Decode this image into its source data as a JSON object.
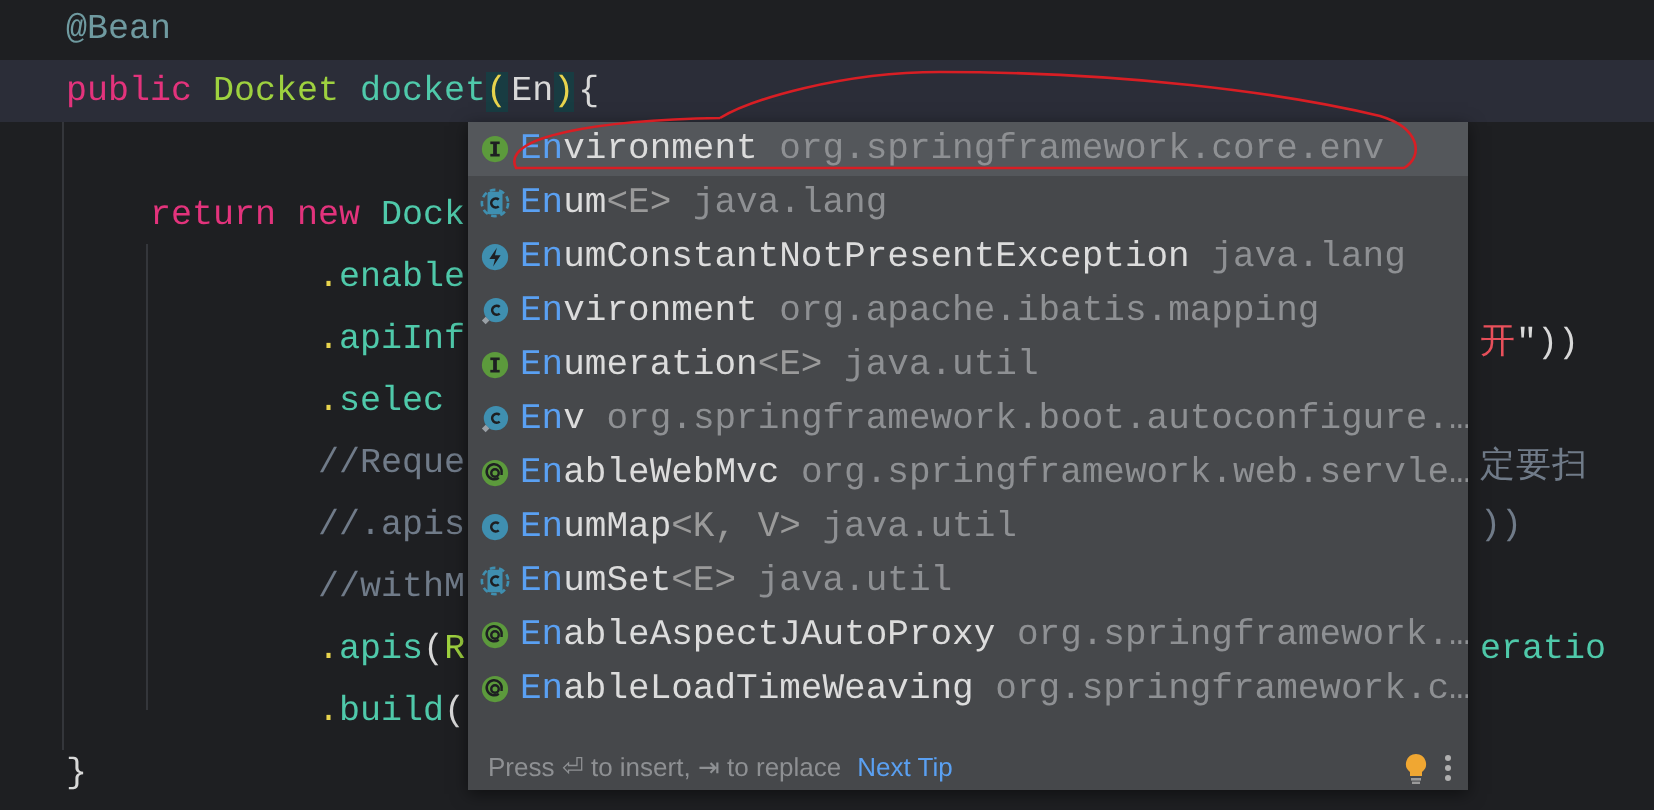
{
  "editor": {
    "lines": [
      {
        "current": false,
        "tokens": [
          {
            "kind": "annotation",
            "text": "@Bean"
          }
        ]
      },
      {
        "current": true,
        "tokens": [
          {
            "kind": "keyword",
            "text": "public "
          },
          {
            "kind": "type",
            "text": "Docket "
          },
          {
            "kind": "method",
            "text": "docket"
          },
          {
            "kind": "bracket-match",
            "text": "("
          },
          {
            "kind": "plain",
            "text": "En"
          },
          {
            "kind": "bracket-match",
            "text": ")"
          },
          {
            "kind": "plain",
            "text": "{"
          }
        ]
      },
      {
        "current": false
      },
      {
        "current": false,
        "tokens": [
          {
            "kind": "keyword",
            "text": "    return new "
          },
          {
            "kind": "method",
            "text": "Dock"
          }
        ]
      },
      {
        "current": false,
        "tokens": [
          {
            "kind": "punct",
            "text": "            ."
          },
          {
            "kind": "method",
            "text": "enable"
          }
        ]
      },
      {
        "current": false,
        "tokens": [
          {
            "kind": "punct",
            "text": "            ."
          },
          {
            "kind": "method",
            "text": "apiInf"
          }
        ],
        "right": [
          {
            "kind": "string",
            "text": "开"
          },
          {
            "kind": "plain",
            "text": "\"))"
          }
        ]
      },
      {
        "current": false,
        "tokens": [
          {
            "kind": "punct",
            "text": "            ."
          },
          {
            "kind": "method",
            "text": "selec"
          }
        ]
      },
      {
        "current": false,
        "tokens": [
          {
            "kind": "comment",
            "text": "            //Reque"
          }
        ],
        "right": [
          {
            "kind": "comment",
            "text": "定要扫"
          }
        ]
      },
      {
        "current": false,
        "tokens": [
          {
            "kind": "comment",
            "text": "            //.apis"
          }
        ],
        "right": [
          {
            "kind": "comment",
            "text": "))"
          }
        ]
      },
      {
        "current": false,
        "tokens": [
          {
            "kind": "comment",
            "text": "            //withM"
          }
        ]
      },
      {
        "current": false,
        "tokens": [
          {
            "kind": "punct",
            "text": "            ."
          },
          {
            "kind": "method",
            "text": "apis"
          },
          {
            "kind": "plain",
            "text": "("
          },
          {
            "kind": "type",
            "text": "R"
          }
        ],
        "right": [
          {
            "kind": "method",
            "text": "eratio"
          }
        ]
      },
      {
        "current": false,
        "tokens": [
          {
            "kind": "punct",
            "text": "            ."
          },
          {
            "kind": "method",
            "text": "build"
          },
          {
            "kind": "plain",
            "text": "("
          }
        ]
      },
      {
        "current": false,
        "tokens": [
          {
            "kind": "plain",
            "text": "}"
          }
        ]
      }
    ]
  },
  "popup": {
    "items": [
      {
        "kind": "interface",
        "selected": true,
        "match": "En",
        "rest": "vironment",
        "package": "org.springframework.core.env"
      },
      {
        "kind": "abstract-class",
        "selected": false,
        "match": "En",
        "rest": "um",
        "generic": "<E>",
        "package": "java.lang"
      },
      {
        "kind": "exception",
        "selected": false,
        "match": "En",
        "rest": "umConstantNotPresentException",
        "package": "java.lang"
      },
      {
        "kind": "final-class",
        "selected": false,
        "match": "En",
        "rest": "vironment",
        "package": "org.apache.ibatis.mapping"
      },
      {
        "kind": "interface",
        "selected": false,
        "match": "En",
        "rest": "umeration",
        "generic": "<E>",
        "package": "java.util"
      },
      {
        "kind": "final-class",
        "selected": false,
        "match": "En",
        "rest": "v",
        "package": "org.springframework.boot.autoconfigure.…"
      },
      {
        "kind": "annotation",
        "selected": false,
        "match": "En",
        "rest": "ableWebMvc",
        "package": "org.springframework.web.servle…"
      },
      {
        "kind": "class",
        "selected": false,
        "match": "En",
        "rest": "umMap",
        "generic": "<K, V>",
        "package": "java.util"
      },
      {
        "kind": "abstract-class",
        "selected": false,
        "match": "En",
        "rest": "umSet",
        "generic": "<E>",
        "package": "java.util"
      },
      {
        "kind": "annotation",
        "selected": false,
        "match": "En",
        "rest": "ableAspectJAutoProxy",
        "package": "org.springframework.…"
      },
      {
        "kind": "annotation",
        "selected": false,
        "match": "En",
        "rest": "ableLoadTimeWeaving",
        "package": "org.springframework.c…"
      }
    ],
    "hint": "Press ⏎ to insert, ⇥ to replace",
    "link": "Next Tip"
  }
}
